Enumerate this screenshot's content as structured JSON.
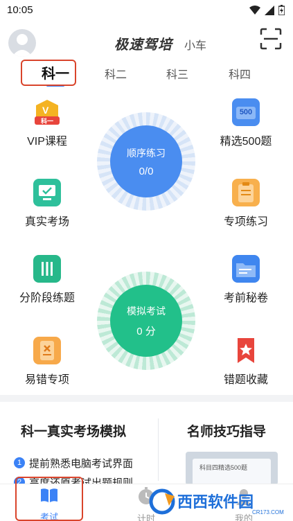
{
  "status": {
    "time": "10:05"
  },
  "header": {
    "brand": "极速驾培",
    "brand_sub": "小车"
  },
  "tabs": [
    {
      "label": "科一",
      "active": true
    },
    {
      "label": "科二",
      "active": false
    },
    {
      "label": "科三",
      "active": false
    },
    {
      "label": "科四",
      "active": false
    }
  ],
  "left_items": [
    {
      "label": "VIP课程",
      "icon": "vip-badge-icon",
      "badge": "科一"
    },
    {
      "label": "真实考场",
      "icon": "monitor-icon"
    },
    {
      "label": "分阶段练题",
      "icon": "columns-icon"
    },
    {
      "label": "易错专项",
      "icon": "error-doc-icon"
    }
  ],
  "right_items": [
    {
      "label": "精选500题",
      "icon": "book-500-icon",
      "badge": "500"
    },
    {
      "label": "专项练习",
      "icon": "clipboard-icon"
    },
    {
      "label": "考前秘卷",
      "icon": "folder-icon"
    },
    {
      "label": "错题收藏",
      "icon": "star-bookmark-icon"
    }
  ],
  "practice_ring": {
    "title": "顺序练习",
    "value": "0/0"
  },
  "exam_ring": {
    "title": "模拟考试",
    "value": "0 分"
  },
  "simulation": {
    "title": "科一真实考场模拟",
    "items": [
      "提前熟悉电脑考试界面",
      "高度还原考试出题规则"
    ]
  },
  "tips": {
    "title": "名师技巧指导",
    "thumb_text": "科目四精选500题"
  },
  "nav": [
    {
      "label": "考试",
      "active": true
    },
    {
      "label": "计时",
      "active": false
    },
    {
      "label": "我的",
      "active": false
    }
  ],
  "watermark": {
    "text": "西西软件园",
    "site": "CR173.COM"
  },
  "colors": {
    "accent": "#3b82f6",
    "exam_green": "#22c08a",
    "highlight": "#d9442b"
  }
}
